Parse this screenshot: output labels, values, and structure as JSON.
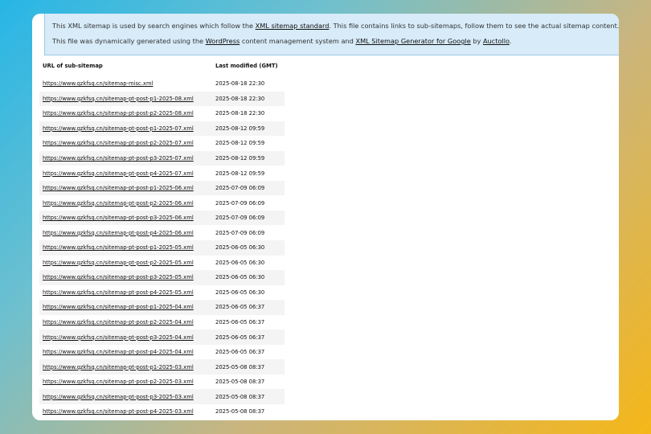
{
  "intro": {
    "line1_a": "This XML sitemap is used by search engines which follow the ",
    "line1_link": "XML sitemap standard",
    "line1_b": ". This file contains links to sub-sitemaps, follow them to see the actual sitemap content.",
    "line2_a": "This file was dynamically generated using the ",
    "line2_link1": "WordPress",
    "line2_b": " content management system and ",
    "line2_link2": "XML Sitemap Generator for Google",
    "line2_c": " by ",
    "line2_link3": "Auctollo",
    "line2_d": "."
  },
  "table": {
    "col_url": "URL of sub-sitemap",
    "col_modified": "Last modified (GMT)",
    "rows": [
      {
        "url": "https://www.qzkfsq.cn/sitemap-misc.xml",
        "modified": "2025-08-18 22:30"
      },
      {
        "url": "https://www.qzkfsq.cn/sitemap-pt-post-p1-2025-08.xml",
        "modified": "2025-08-18 22:30"
      },
      {
        "url": "https://www.qzkfsq.cn/sitemap-pt-post-p2-2025-08.xml",
        "modified": "2025-08-18 22:30"
      },
      {
        "url": "https://www.qzkfsq.cn/sitemap-pt-post-p1-2025-07.xml",
        "modified": "2025-08-12 09:59"
      },
      {
        "url": "https://www.qzkfsq.cn/sitemap-pt-post-p2-2025-07.xml",
        "modified": "2025-08-12 09:59"
      },
      {
        "url": "https://www.qzkfsq.cn/sitemap-pt-post-p3-2025-07.xml",
        "modified": "2025-08-12 09:59"
      },
      {
        "url": "https://www.qzkfsq.cn/sitemap-pt-post-p4-2025-07.xml",
        "modified": "2025-08-12 09:59"
      },
      {
        "url": "https://www.qzkfsq.cn/sitemap-pt-post-p1-2025-06.xml",
        "modified": "2025-07-09 06:09"
      },
      {
        "url": "https://www.qzkfsq.cn/sitemap-pt-post-p2-2025-06.xml",
        "modified": "2025-07-09 06:09"
      },
      {
        "url": "https://www.qzkfsq.cn/sitemap-pt-post-p3-2025-06.xml",
        "modified": "2025-07-09 06:09"
      },
      {
        "url": "https://www.qzkfsq.cn/sitemap-pt-post-p4-2025-06.xml",
        "modified": "2025-07-09 06:09"
      },
      {
        "url": "https://www.qzkfsq.cn/sitemap-pt-post-p1-2025-05.xml",
        "modified": "2025-06-05 06:30"
      },
      {
        "url": "https://www.qzkfsq.cn/sitemap-pt-post-p2-2025-05.xml",
        "modified": "2025-06-05 06:30"
      },
      {
        "url": "https://www.qzkfsq.cn/sitemap-pt-post-p3-2025-05.xml",
        "modified": "2025-06-05 06:30"
      },
      {
        "url": "https://www.qzkfsq.cn/sitemap-pt-post-p4-2025-05.xml",
        "modified": "2025-06-05 06:30"
      },
      {
        "url": "https://www.qzkfsq.cn/sitemap-pt-post-p1-2025-04.xml",
        "modified": "2025-06-05 06:37"
      },
      {
        "url": "https://www.qzkfsq.cn/sitemap-pt-post-p2-2025-04.xml",
        "modified": "2025-06-05 06:37"
      },
      {
        "url": "https://www.qzkfsq.cn/sitemap-pt-post-p3-2025-04.xml",
        "modified": "2025-06-05 06:37"
      },
      {
        "url": "https://www.qzkfsq.cn/sitemap-pt-post-p4-2025-04.xml",
        "modified": "2025-06-05 06:37"
      },
      {
        "url": "https://www.qzkfsq.cn/sitemap-pt-post-p1-2025-03.xml",
        "modified": "2025-05-08 08:37"
      },
      {
        "url": "https://www.qzkfsq.cn/sitemap-pt-post-p2-2025-03.xml",
        "modified": "2025-05-08 08:37"
      },
      {
        "url": "https://www.qzkfsq.cn/sitemap-pt-post-p3-2025-03.xml",
        "modified": "2025-05-08 08:37"
      },
      {
        "url": "https://www.qzkfsq.cn/sitemap-pt-post-p4-2025-03.xml",
        "modified": "2025-05-08 08:37"
      }
    ]
  }
}
